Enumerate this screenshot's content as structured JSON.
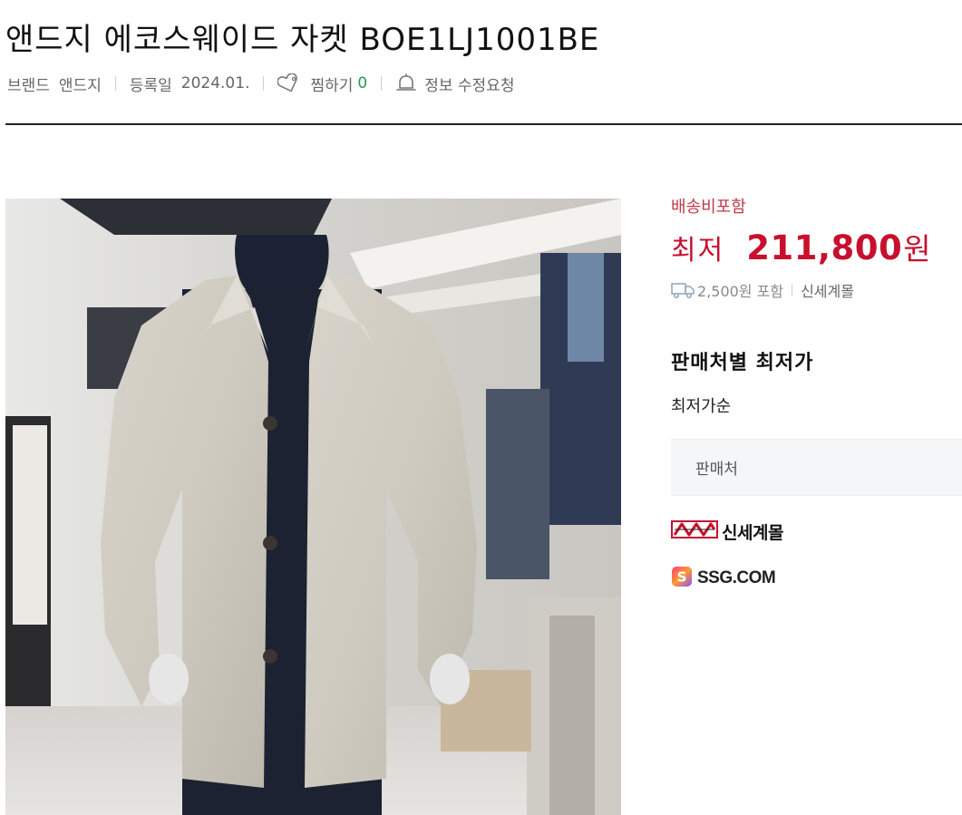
{
  "product": {
    "title": "앤드지 에코스웨이드 자켓 BOE1LJ1001BE"
  },
  "meta": {
    "brand_label": "브랜드",
    "brand_value": "앤드지",
    "registered_label": "등록일",
    "registered_value": "2024.01.",
    "wishlist_label": "찜하기",
    "wishlist_count": "0",
    "edit_request_label": "정보 수정요청",
    "wishlist_icon": "heart-tag-icon",
    "edit_request_icon": "bell-icon"
  },
  "pricing": {
    "shipping_included_label": "배송비포함",
    "lowest_prefix": "최저",
    "lowest_price": "211,800",
    "currency_unit": "원",
    "shipping_fee_text": "2,500원 포함",
    "seller_name": "신세계몰",
    "price_color": "#c8102e",
    "shipping_icon": "delivery-truck-icon"
  },
  "sellers_section": {
    "title": "판매처별 최저가",
    "sort_label": "최저가순",
    "column_header": "판매처",
    "sellers": [
      {
        "name": "신세계몰",
        "logo_icon": "shinsegae-mall-logo"
      },
      {
        "name": "SSG.COM",
        "logo_icon": "ssg-com-logo"
      }
    ]
  },
  "colors": {
    "accent_red": "#c8102e",
    "shipping_label_red": "#c0394a",
    "wishlist_count_green": "#1f9d55",
    "seller_header_bg": "#f5f6f8"
  }
}
